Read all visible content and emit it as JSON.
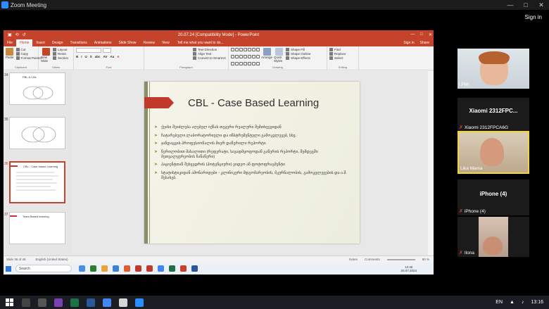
{
  "zoom": {
    "title": "Zoom Meeting",
    "signin": "Sign in",
    "window_controls": [
      "—",
      "□",
      "✕"
    ]
  },
  "powerpoint": {
    "quick_access": [
      "⟲",
      "↺",
      "▣"
    ],
    "title": "20.07.24 [Compatibility Mode] - PowerPoint",
    "window_controls": [
      "—",
      "□",
      "✕"
    ],
    "tabs": [
      "File",
      "Home",
      "Insert",
      "Design",
      "Transitions",
      "Animations",
      "Slide Show",
      "Review",
      "View"
    ],
    "tell_me": "Tell me what you want to do...",
    "signin": "Sign in",
    "share": "Share",
    "ribbon": {
      "clipboard": {
        "label": "Clipboard",
        "paste": "Paste",
        "cut": "Cut",
        "copy": "Copy",
        "format_painter": "Format Painter"
      },
      "slides": {
        "label": "Slides",
        "new_slide": "New Slide",
        "layout": "Layout",
        "reset": "Reset",
        "section": "Section"
      },
      "font": {
        "label": "Font",
        "buttons": [
          "B",
          "I",
          "U",
          "S",
          "abc",
          "AV",
          "Aa",
          "A"
        ]
      },
      "paragraph": {
        "label": "Paragraph",
        "text_direction": "Text Direction",
        "align_text": "Align Text",
        "convert_smartart": "Convert to SmartArt"
      },
      "drawing": {
        "label": "Drawing",
        "arrange": "Arrange",
        "quick_styles": "Quick Styles",
        "shape_fill": "Shape Fill",
        "shape_outline": "Shape Outline",
        "shape_effects": "Shape Effects"
      },
      "editing": {
        "label": "Editing",
        "find": "Find",
        "replace": "Replace",
        "select": "Select"
      }
    },
    "thumbnails": [
      {
        "num": "34",
        "title": "PBL & CBL"
      },
      {
        "num": "35",
        "title": ""
      },
      {
        "num": "36",
        "title": "CBL - Case based Learning"
      },
      {
        "num": "37",
        "title": "Team Based learning"
      }
    ],
    "slide": {
      "title": "CBL - Case Based Learning",
      "bullets": [
        "ქეისი შეიძლება აღებულ იქნას თგჯერი რეალური შემთხვევიდან",
        "ჩატარებული ლაბორატორიული და ინსტრუმენტული გამოკვლევებ, სხვ.",
        "ჯანდაცვის პროფესიონალის მიერ დაწერილი რეპორტი",
        "წერილობით მასალითი (რეფერატი, სავადმყოფოდან გაწერის რეპორტი, შემდეგში მეთვალყურეობის ჩანაწერი)",
        "პაციენტთან შეხვედრის (პოტენციური) ვიდეო ან ფოტოფრაგმენტი",
        "სტატისტიკიდან ამონარიდები - კლინიკური მდგომარეობის, მკურნალობის, გამოკვლევების და ა.შ. შესახებ."
      ]
    },
    "status": {
      "slide_of": "Slide 36 of 46",
      "language": "English (United States)",
      "notes": "Notes",
      "comments": "Comments",
      "zoom": "80 %"
    },
    "taskbar": {
      "search": "Search",
      "time": "12:46",
      "date": "20.07.2024"
    }
  },
  "participants": [
    {
      "name": "l Pkh",
      "type": "video"
    },
    {
      "name": "Xiaomi 2312FPCA6G",
      "display": "Xiaomi 2312FPC...",
      "type": "name"
    },
    {
      "name": "Lika Mania",
      "type": "video"
    },
    {
      "name": "iPhone (4)",
      "display": "iPhone (4)",
      "type": "name"
    },
    {
      "name": "Ilona",
      "type": "video"
    }
  ],
  "system_taskbar": {
    "language": "EN",
    "time": "13:16"
  },
  "colors": {
    "pp_accent": "#c4432a",
    "bullet_arrow": "#7d9b2a",
    "speaking_highlight": "#f0d63c"
  }
}
